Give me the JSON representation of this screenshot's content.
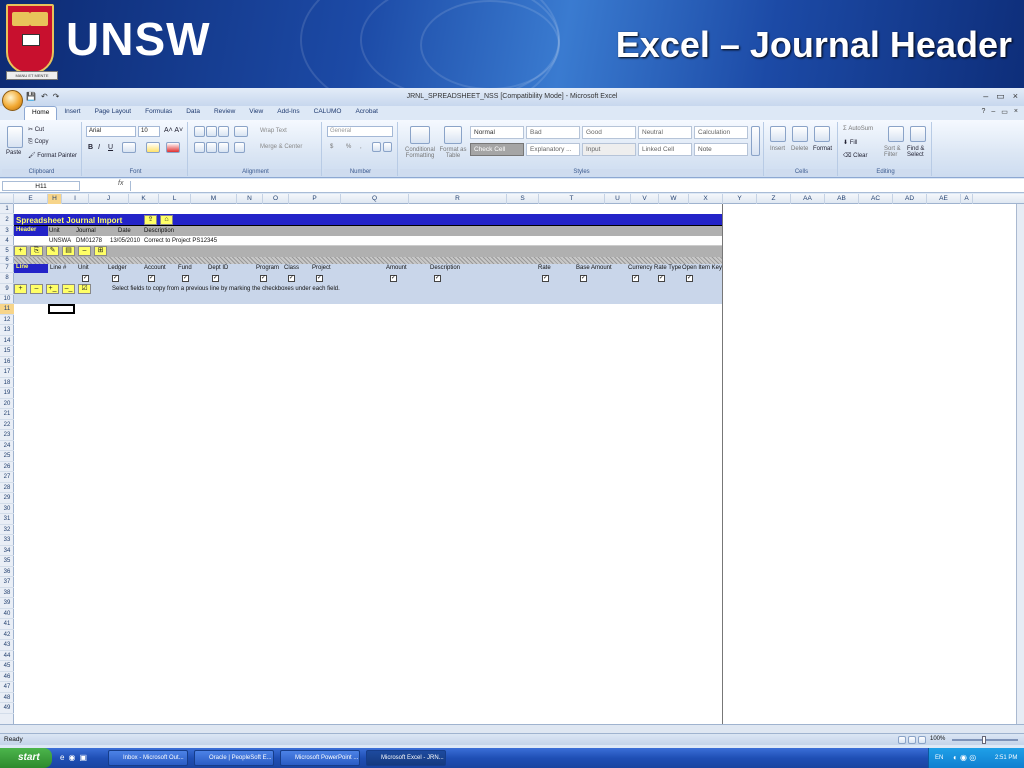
{
  "slide": {
    "logo_text": "UNSW",
    "crest_motto": "MANU ET MENTE",
    "title": "Excel – Journal Header"
  },
  "window": {
    "title": "JRNL_SPREADSHEET_NSS [Compatibility Mode] - Microsoft Excel",
    "controls": [
      "–",
      "▭",
      "×"
    ]
  },
  "ribbon_tabs": [
    "Home",
    "Insert",
    "Page Layout",
    "Formulas",
    "Data",
    "Review",
    "View",
    "Add-Ins",
    "CALUMO",
    "Acrobat"
  ],
  "ribbon": {
    "clipboard": {
      "paste": "Paste",
      "cut": "Cut",
      "copy": "Copy",
      "format_painter": "Format Painter",
      "label": "Clipboard"
    },
    "font": {
      "name": "Arial",
      "size": "10",
      "bold": "B",
      "italic": "I",
      "underline": "U",
      "label": "Font"
    },
    "alignment": {
      "wrap": "Wrap Text",
      "merge": "Merge & Center",
      "label": "Alignment"
    },
    "number": {
      "format": "General",
      "currency": "$",
      "percent": "%",
      "comma": ",",
      "label": "Number"
    },
    "styles": {
      "conditional": "Conditional Formatting",
      "format_table": "Format as Table",
      "cells": [
        "Normal",
        "Bad",
        "Good",
        "Neutral",
        "Calculation",
        "Check Cell",
        "Explanatory ...",
        "Input",
        "Linked Cell",
        "Note"
      ],
      "label": "Styles"
    },
    "cells": {
      "insert": "Insert",
      "delete": "Delete",
      "format": "Format",
      "label": "Cells"
    },
    "editing": {
      "autosum": "AutoSum",
      "fill": "Fill",
      "clear": "Clear",
      "sort": "Sort & Filter",
      "find": "Find & Select",
      "label": "Editing"
    }
  },
  "formula_bar": {
    "name_box": "H11",
    "fx": "fx",
    "content": ""
  },
  "columns": [
    "E",
    "H",
    "I",
    "J",
    "K",
    "L",
    "M",
    "N",
    "O",
    "P",
    "Q",
    "R",
    "S",
    "T",
    "U",
    "V",
    "W",
    "X",
    "Y",
    "Z",
    "AA",
    "AB",
    "AC",
    "AD",
    "AE",
    "A"
  ],
  "rows": [
    "1",
    "2",
    "3",
    "4",
    "5",
    "6",
    "7",
    "8",
    "9",
    "10",
    "11",
    "12",
    "13",
    "14",
    "15",
    "16",
    "17",
    "18",
    "19",
    "20",
    "21",
    "22",
    "23",
    "24",
    "25",
    "26",
    "27",
    "28",
    "29",
    "30",
    "31",
    "32",
    "33",
    "34",
    "35",
    "36",
    "37",
    "38",
    "39",
    "40",
    "41",
    "42",
    "43",
    "44",
    "45",
    "46",
    "47",
    "48",
    "49"
  ],
  "sheet": {
    "import_title": "Spreadsheet Journal Import",
    "header_label": "Header",
    "header_cols": {
      "unit": "Unit",
      "journal": "Journal",
      "date": "Date",
      "description": "Description"
    },
    "header_values": {
      "unit": "UNSWA",
      "journal": "DM01278",
      "date": "13/05/2010",
      "description": "Correct to Project PS12345"
    },
    "line_label": "Line",
    "line_cols": [
      "Line #",
      "Unit",
      "Ledger",
      "Account",
      "Fund",
      "Dept ID",
      "Program",
      "Class",
      "Project",
      "Amount",
      "Description",
      "Rate",
      "Base Amount",
      "Currency",
      "Rate Type",
      "Open Item Key"
    ],
    "copy_hint": "Select fields to copy from a previous line by marking the checkboxes under each field.",
    "header_buttons": [
      "+",
      "⎘",
      "✎",
      "▤",
      "–",
      "⊞"
    ],
    "line_buttons": [
      "+",
      "–",
      "+_",
      "–_",
      "☑"
    ]
  },
  "status": {
    "ready": "Ready",
    "zoom": "100%"
  },
  "taskbar": {
    "start": "start",
    "tasks": [
      "Inbox - Microsoft Out...",
      "Oracle | PeopleSoft E...",
      "Microsoft PowerPoint ...",
      "Microsoft Excel - JRN..."
    ],
    "lang": "EN",
    "time": "2:51 PM"
  },
  "colors": {
    "header_band": "#2323c8",
    "yellow_button": "#ffff66",
    "row_band": "#c9d6ea",
    "gray_band": "#b0b0b0"
  }
}
